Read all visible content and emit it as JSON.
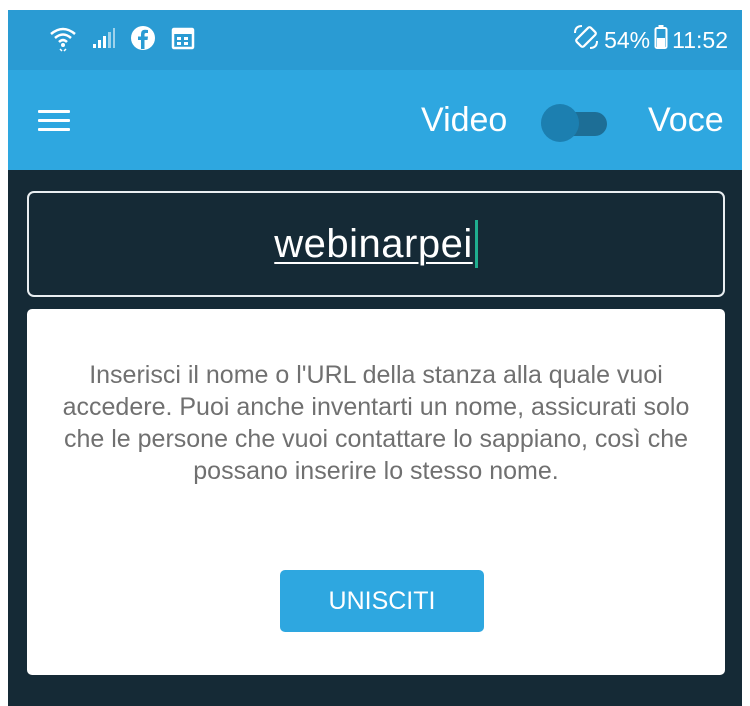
{
  "status_bar": {
    "battery_percent": "54%",
    "time": "11:52",
    "icons": [
      "wifi-icon",
      "signal-icon",
      "facebook-icon",
      "calendar-icon",
      "rotate-icon",
      "battery-icon"
    ]
  },
  "app_bar": {
    "menu_icon": "hamburger-menu-icon",
    "video_label": "Video",
    "voice_label": "Voce",
    "mode_toggle_on": false
  },
  "room": {
    "value": "webinarpei"
  },
  "card": {
    "instructions": "Inserisci il nome o l'URL della stanza alla quale vuoi accedere. Puoi anche inventarti un nome, assicurati solo che le persone che vuoi contattare lo sappiano, così che possano inserire lo stesso nome.",
    "join_label": "UNISCITI"
  },
  "colors": {
    "status_bar": "#2a9bd3",
    "app_bar": "#2ea7e0",
    "background": "#152a36",
    "caret": "#1fae8f",
    "button": "#2ea7e0"
  }
}
